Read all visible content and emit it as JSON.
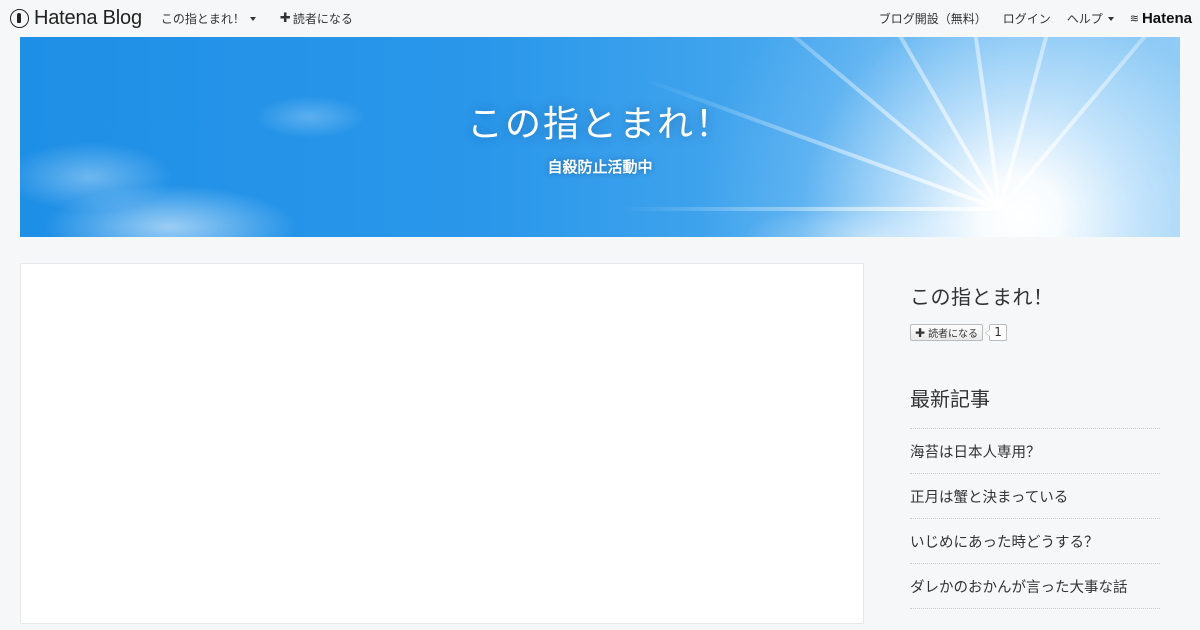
{
  "topbar": {
    "brand": "Hatena Blog",
    "blog_menu_label": "この指とまれ！",
    "subscribe_label": "読者になる",
    "signup_label": "ブログ開設（無料）",
    "login_label": "ログイン",
    "help_label": "ヘルプ",
    "hatena_label": "Hatena"
  },
  "banner": {
    "title": "この指とまれ！",
    "subtitle": "自殺防止活動中"
  },
  "sidebar": {
    "blog_title": "この指とまれ！",
    "subscribe_button": "読者になる",
    "subscriber_count": "1",
    "recent_heading": "最新記事",
    "recent_posts": [
      "海苔は日本人専用？",
      "正月は蟹と決まっている",
      "いじめにあった時どうする？",
      "ダレかのおかんが言った大事な話"
    ]
  },
  "colors": {
    "page_background": "#f6f7f9",
    "banner_sky": "#2a97ea",
    "text": "#333333"
  }
}
